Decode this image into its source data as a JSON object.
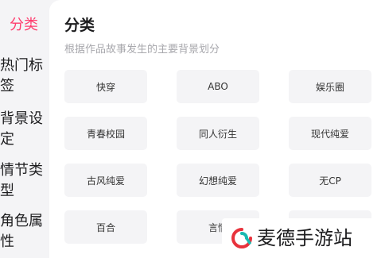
{
  "sidebar": {
    "items": [
      {
        "line1": "分类",
        "line2": ""
      },
      {
        "line1": "热门标",
        "line2": "签"
      },
      {
        "line1": "背景设",
        "line2": "定"
      },
      {
        "line1": "情节类",
        "line2": "型"
      },
      {
        "line1": "角色属",
        "line2": "性"
      }
    ]
  },
  "main": {
    "title": "分类",
    "subtitle": "根据作品故事发生的主要背景划分",
    "tags": [
      "快穿",
      "ABO",
      "娱乐圈",
      "青春校园",
      "同人衍生",
      "现代纯爱",
      "古风纯爱",
      "幻想纯爱",
      "无CP",
      "百合",
      "言情",
      ""
    ]
  },
  "watermark": {
    "text": "麦德手游站"
  },
  "colors": {
    "accent": "#ff3d6e",
    "tag_bg": "#f4f4f6",
    "logo_red": "#e8323c",
    "logo_teal": "#19b9b0"
  },
  "icons": {
    "watermark_logo": "mdsyz-logo-icon"
  }
}
